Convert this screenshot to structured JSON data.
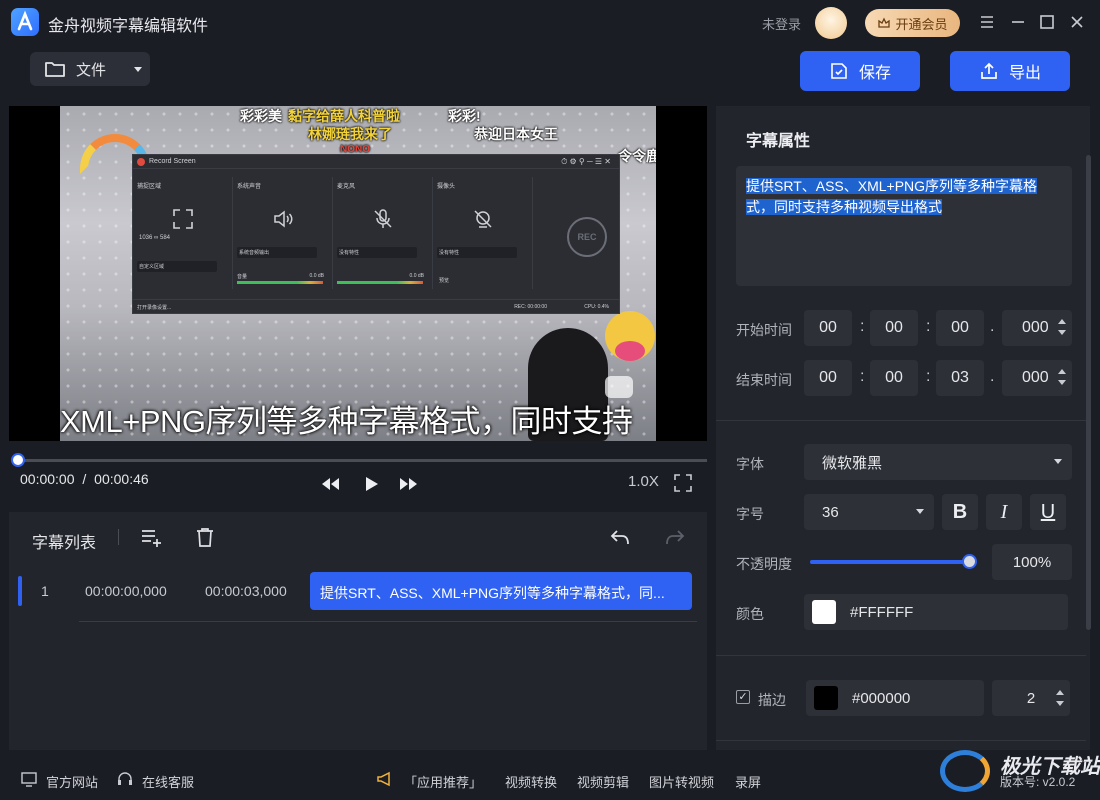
{
  "app": {
    "title": "金舟视频字幕编辑软件",
    "login_status": "未登录",
    "vip_label": "开通会员"
  },
  "toolbar": {
    "file_label": "文件",
    "save_label": "保存",
    "export_label": "导出"
  },
  "video": {
    "top_captions": [
      "彩彩美",
      "黏字给薛人科普啦",
      "彩彩!",
      "林娜琏我来了",
      "恭迎日本女王",
      "NONO",
      "令令鹿"
    ],
    "bottom_caption": "XML+PNG序列等多种字幕格式，同时支持",
    "record_window": {
      "title": "Record Screen",
      "columns": [
        "捕捉区域",
        "系统声音",
        "麦克风",
        "摄像头"
      ],
      "width_val": "1036",
      "height_val": "584",
      "area_select": "自定义区域",
      "sys_audio_select": "系统音频输出",
      "mic_select": "没有特性",
      "cam_select": "没有特性",
      "volume_label": "音量",
      "db1": "0.0 dB",
      "db2": "0.0 dB",
      "preview_label": "预览",
      "footer_left": "打开录像设置...",
      "footer_rec": "REC: 00:00:00",
      "footer_cpu": "CPU: 0.4%",
      "rec_button": "REC"
    }
  },
  "player": {
    "current_time": "00:00:00",
    "separator": "/",
    "total_time": "00:00:46",
    "speed": "1.0X",
    "progress": 0
  },
  "subtitle_list": {
    "title": "字幕列表",
    "rows": [
      {
        "index": "1",
        "start": "00:00:00,000",
        "end": "00:00:03,000",
        "text": "提供SRT、ASS、XML+PNG序列等多种字幕格式，同..."
      }
    ]
  },
  "properties": {
    "title": "字幕属性",
    "text_line1": "提供SRT、ASS、XML+PNG序列等多种字幕格",
    "text_line2": "式，同时支持多种视频导出格式",
    "start_label": "开始时间",
    "start": {
      "h": "00",
      "m": "00",
      "s": "00",
      "ms": "000"
    },
    "end_label": "结束时间",
    "end": {
      "h": "00",
      "m": "00",
      "s": "03",
      "ms": "000"
    },
    "font_label": "字体",
    "font_value": "微软雅黑",
    "size_label": "字号",
    "size_value": "36",
    "bold": "B",
    "italic": "I",
    "underline": "U",
    "opacity_label": "不透明度",
    "opacity_value": "100%",
    "opacity": 1.0,
    "color_label": "颜色",
    "color_value": "#FFFFFF",
    "stroke_label": "描边",
    "stroke_color": "#000000",
    "stroke_width": "2"
  },
  "statusbar": {
    "website": "官方网站",
    "service": "在线客服",
    "recommend": "「应用推荐」",
    "links": [
      "视频转换",
      "视频剪辑",
      "图片转视频",
      "录屏"
    ],
    "version": "版本号: v2.0.2",
    "watermark": "极光下载站"
  },
  "colors": {
    "accent": "#2f62f2",
    "highlight": "#1f63cf",
    "vip": "#e9b67f"
  }
}
